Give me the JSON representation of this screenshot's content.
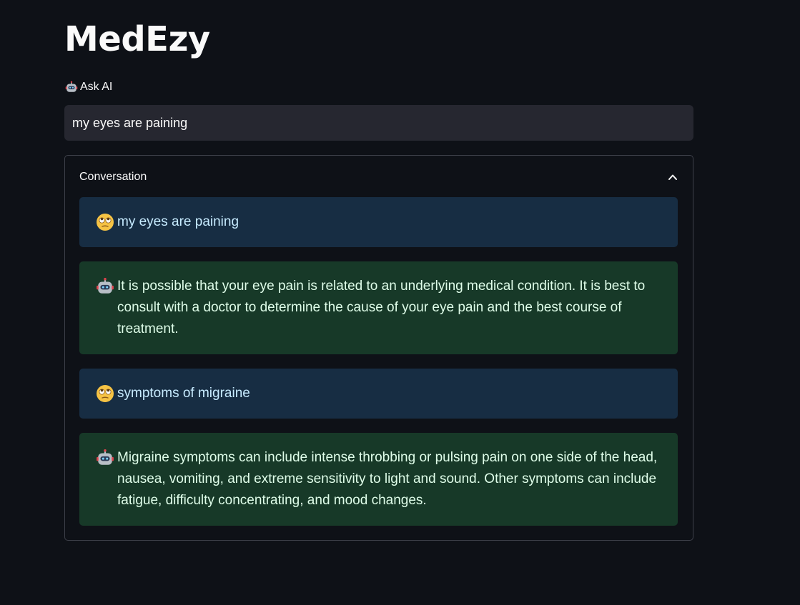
{
  "app": {
    "title": "MedEzy"
  },
  "ask": {
    "label": "Ask AI",
    "icon": "robot-icon",
    "input_value": "my eyes are paining"
  },
  "conversation": {
    "title": "Conversation",
    "expanded": true,
    "messages": [
      {
        "role": "user",
        "icon": "face-with-rolling-eyes-icon",
        "text": "my eyes are paining"
      },
      {
        "role": "ai",
        "icon": "robot-icon",
        "text": "It is possible that your eye pain is related to an underlying medical condition. It is best to consult with a doctor to determine the cause of your eye pain and the best course of treatment."
      },
      {
        "role": "user",
        "icon": "face-with-rolling-eyes-icon",
        "text": "symptoms of migraine"
      },
      {
        "role": "ai",
        "icon": "robot-icon",
        "text": "Migraine symptoms can include intense throbbing or pulsing pain on one side of the head, nausea, vomiting, and extreme sensitivity to light and sound. Other symptoms can include fatigue, difficulty concentrating, and mood changes."
      }
    ]
  },
  "colors": {
    "background": "#0e1117",
    "input_background": "#262730",
    "user_message_bg": "#172d43",
    "ai_message_bg": "#173928"
  }
}
